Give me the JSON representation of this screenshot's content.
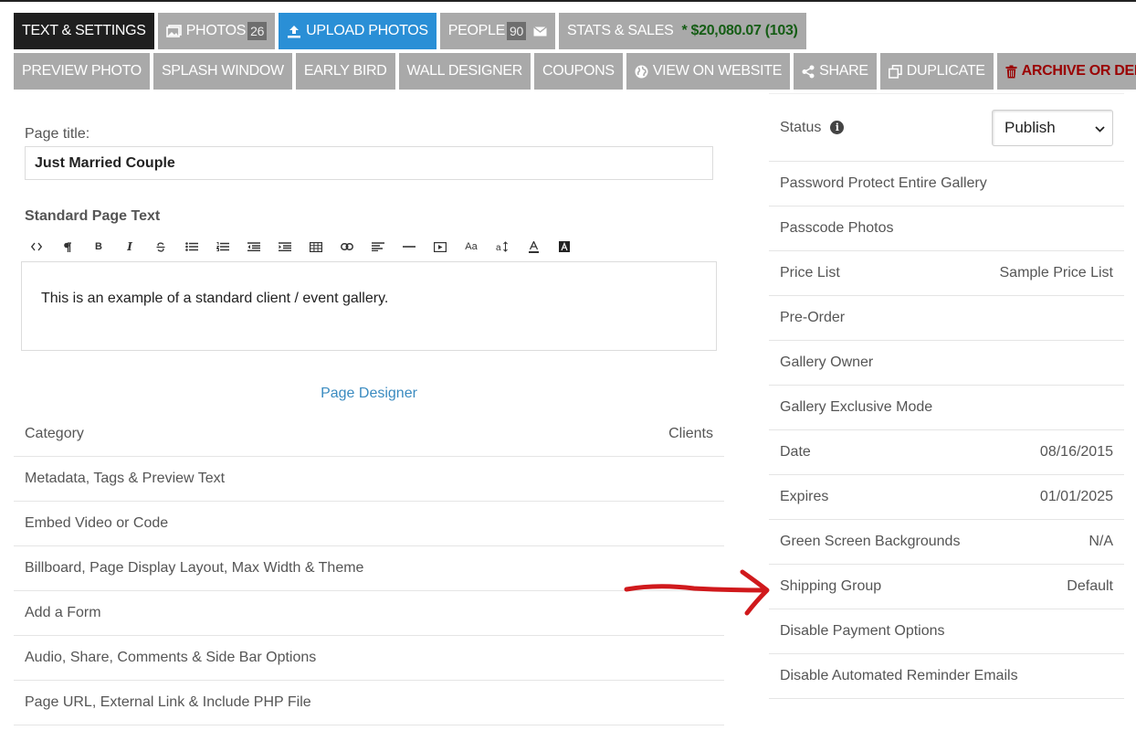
{
  "tabs_row1": [
    {
      "label": "TEXT & SETTINGS"
    },
    {
      "label": "PHOTOS",
      "badge": "26",
      "icon": "photos-icon"
    },
    {
      "label": "UPLOAD PHOTOS",
      "icon": "upload-icon"
    },
    {
      "label": "PEOPLE",
      "badge": "90",
      "icon": "envelope-icon"
    },
    {
      "label": "STATS & SALES",
      "sales": "* $20,080.07 (103)"
    }
  ],
  "tabs_row2": [
    {
      "label": "PREVIEW PHOTO"
    },
    {
      "label": "SPLASH WINDOW"
    },
    {
      "label": "EARLY BIRD"
    },
    {
      "label": "WALL DESIGNER"
    },
    {
      "label": "COUPONS"
    },
    {
      "label": "VIEW ON WEBSITE",
      "icon": "globe-icon"
    },
    {
      "label": "SHARE",
      "icon": "share-icon"
    },
    {
      "label": "DUPLICATE",
      "icon": "duplicate-icon"
    },
    {
      "label": "ARCHIVE OR DELETE",
      "icon": "trash-icon"
    }
  ],
  "form": {
    "page_title_label": "Page title:",
    "page_title_value": "Just Married Couple",
    "standard_text_label": "Standard Page Text",
    "editor_text": "This is an example of a standard client  / event gallery.",
    "page_designer_link": "Page Designer"
  },
  "left_list": {
    "header_left": "Category",
    "header_right": "Clients",
    "items": [
      "Metadata, Tags & Preview Text",
      "Embed Video or Code",
      "Billboard, Page Display Layout, Max Width & Theme",
      "Add a Form",
      "Audio, Share, Comments & Side Bar Options",
      "Page URL, External Link & Include PHP File"
    ]
  },
  "right_panel": {
    "status_label": "Status",
    "status_value": "Publish",
    "rows": [
      {
        "label": "Password Protect Entire Gallery",
        "value": ""
      },
      {
        "label": "Passcode Photos",
        "value": ""
      },
      {
        "label": "Price List",
        "value": "Sample Price List"
      },
      {
        "label": "Pre-Order",
        "value": ""
      },
      {
        "label": "Gallery Owner",
        "value": ""
      },
      {
        "label": "Gallery Exclusive Mode",
        "value": ""
      },
      {
        "label": "Date",
        "value": "08/16/2015"
      },
      {
        "label": "Expires",
        "value": "01/01/2025"
      },
      {
        "label": "Green Screen Backgrounds",
        "value": "N/A"
      },
      {
        "label": "Shipping Group",
        "value": "Default"
      },
      {
        "label": "Disable Payment Options",
        "value": ""
      },
      {
        "label": "Disable Automated Reminder Emails",
        "value": ""
      }
    ]
  },
  "colors": {
    "tab_gray": "#a9a9a9",
    "tab_active": "#1f1f1f",
    "tab_upload": "#2a8fd6",
    "sales_green": "#155d15",
    "archive_red": "#9a0000",
    "link_blue": "#3a8bc0",
    "annotation_red": "#d0191c"
  },
  "editor_toolbar_icons": [
    "code-icon",
    "paragraph-icon",
    "bold-icon",
    "italic-icon",
    "strikethrough-icon",
    "bullet-list-icon",
    "numbered-list-icon",
    "outdent-icon",
    "indent-icon",
    "table-icon",
    "link-icon",
    "align-icon",
    "horizontal-rule-icon",
    "video-icon",
    "font-size-icon",
    "line-height-icon",
    "text-color-icon",
    "background-color-icon"
  ]
}
